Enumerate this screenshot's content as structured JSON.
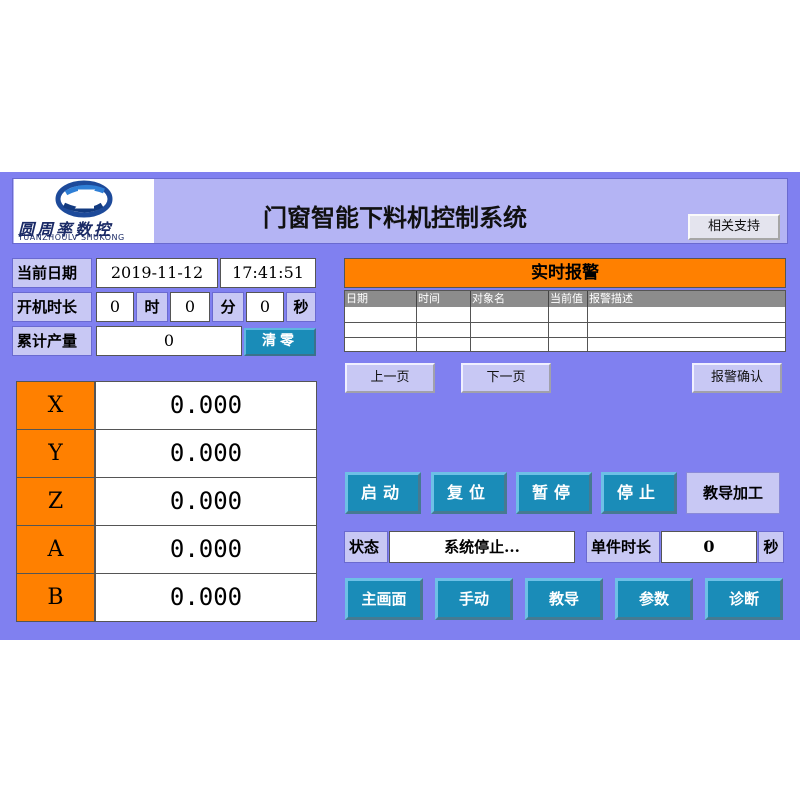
{
  "header": {
    "logo_cn": "圆周率数控",
    "logo_en": "YUANZHOULV SHUKONG",
    "title": "门窗智能下料机控制系统",
    "support_label": "相关支持"
  },
  "info": {
    "date_label": "当前日期",
    "date_value": "2019-11-12",
    "time_value": "17:41:51",
    "uptime_label": "开机时长",
    "hours_value": "0",
    "hours_unit": "时",
    "minutes_value": "0",
    "minutes_unit": "分",
    "seconds_value": "0",
    "seconds_unit": "秒",
    "output_label": "累计产量",
    "output_value": "0",
    "clear_label": "清零"
  },
  "axes": [
    {
      "name": "X",
      "value": "0.000"
    },
    {
      "name": "Y",
      "value": "0.000"
    },
    {
      "name": "Z",
      "value": "0.000"
    },
    {
      "name": "A",
      "value": "0.000"
    },
    {
      "name": "B",
      "value": "0.000"
    }
  ],
  "alarm": {
    "title": "实时报警",
    "columns": [
      "日期",
      "时间",
      "对象名",
      "当前值",
      "报警描述"
    ],
    "prev_label": "上一页",
    "next_label": "下一页",
    "confirm_label": "报警确认"
  },
  "controls": {
    "start": "启动",
    "reset": "复位",
    "pause": "暂停",
    "stop": "停止",
    "teach_process": "教导加工"
  },
  "status": {
    "label": "状态",
    "value": "系统停止...",
    "cycle_label": "单件时长",
    "cycle_value": "0",
    "cycle_unit": "秒"
  },
  "menu": {
    "main": "主画面",
    "manual": "手动",
    "teach": "教导",
    "params": "参数",
    "diag": "诊断"
  },
  "colors": {
    "background": "#8080f0",
    "accent_orange": "#ff8000",
    "button_blue": "#1a8cb8"
  }
}
